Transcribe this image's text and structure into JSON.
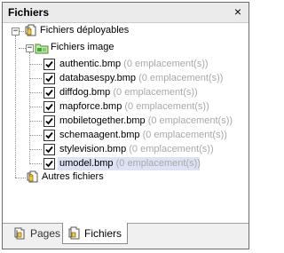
{
  "panel": {
    "title": "Fichiers",
    "close_glyph": "×"
  },
  "tree": {
    "root_label": "Fichiers déployables",
    "image_folder_label": "Fichiers image",
    "files": [
      {
        "name": "authentic.bmp",
        "count": "(0 emplacement(s))",
        "checked": true
      },
      {
        "name": "databasespy.bmp",
        "count": "(0 emplacement(s))",
        "checked": true
      },
      {
        "name": "diffdog.bmp",
        "count": "(0 emplacement(s))",
        "checked": true
      },
      {
        "name": "mapforce.bmp",
        "count": "(0 emplacement(s))",
        "checked": true
      },
      {
        "name": "mobiletogether.bmp",
        "count": "(0 emplacement(s))",
        "checked": true
      },
      {
        "name": "schemaagent.bmp",
        "count": "(0 emplacement(s))",
        "checked": true
      },
      {
        "name": "stylevision.bmp",
        "count": "(0 emplacement(s))",
        "checked": true
      },
      {
        "name": "umodel.bmp",
        "count": "(0 emplacement(s))",
        "checked": true,
        "selected": true
      }
    ],
    "other_label": "Autres fichiers",
    "collapse_glyph": "−"
  },
  "tabs": {
    "pages_label": "Pages",
    "fichiers_label": "Fichiers",
    "active": "Fichiers"
  },
  "colors": {
    "selection": "#dde3f5",
    "count_text": "#a8a8a8",
    "folder_green": "#3aa83a"
  },
  "icons": {
    "root": "document-stack-icon",
    "image_folder": "image-folder-icon",
    "other": "document-stack-icon",
    "pages_tab": "pages-icon",
    "fichiers_tab": "files-icon"
  }
}
